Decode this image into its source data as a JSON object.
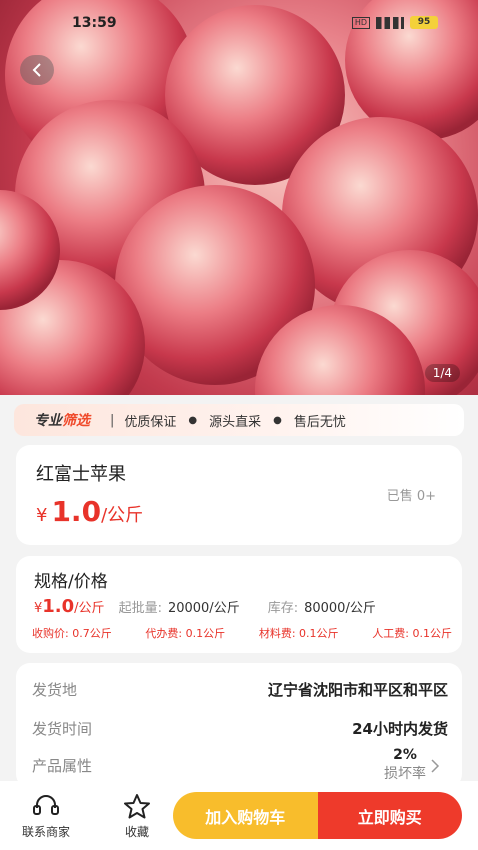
{
  "status_bar": {
    "time": "13:59",
    "hd": "HD",
    "battery": "95"
  },
  "gallery": {
    "page_indicator": "1/4"
  },
  "promo": {
    "title_prefix": "专业",
    "title_highlight": "筛选",
    "tags": [
      "优质保证",
      "源头直采",
      "售后无忧"
    ]
  },
  "product": {
    "name": "红富士苹果",
    "currency": "¥",
    "price": "1.0",
    "unit": "/公斤",
    "sold": "已售 0+"
  },
  "spec": {
    "title": "规格/价格",
    "price": "1.0",
    "unit": "/公斤",
    "moq_label": "起批量:",
    "moq_value": "20000/公斤",
    "stock_label": "库存:",
    "stock_value": "80000/公斤",
    "fees": [
      "收购价: 0.7公斤",
      "代办费: 0.1公斤",
      "材料费: 0.1公斤",
      "人工费: 0.1公斤"
    ]
  },
  "info": {
    "origin_label": "发货地",
    "origin_value": "辽宁省沈阳市和平区和平区",
    "ship_time_label": "发货时间",
    "ship_time_value": "24小时内发货",
    "attr_label": "产品属性",
    "attr_pct": "2%",
    "attr_sub": "损坏率"
  },
  "bottom": {
    "contact_label": "联系商家",
    "fav_label": "收藏",
    "cart_label": "加入购物车",
    "buy_label": "立即购买"
  }
}
